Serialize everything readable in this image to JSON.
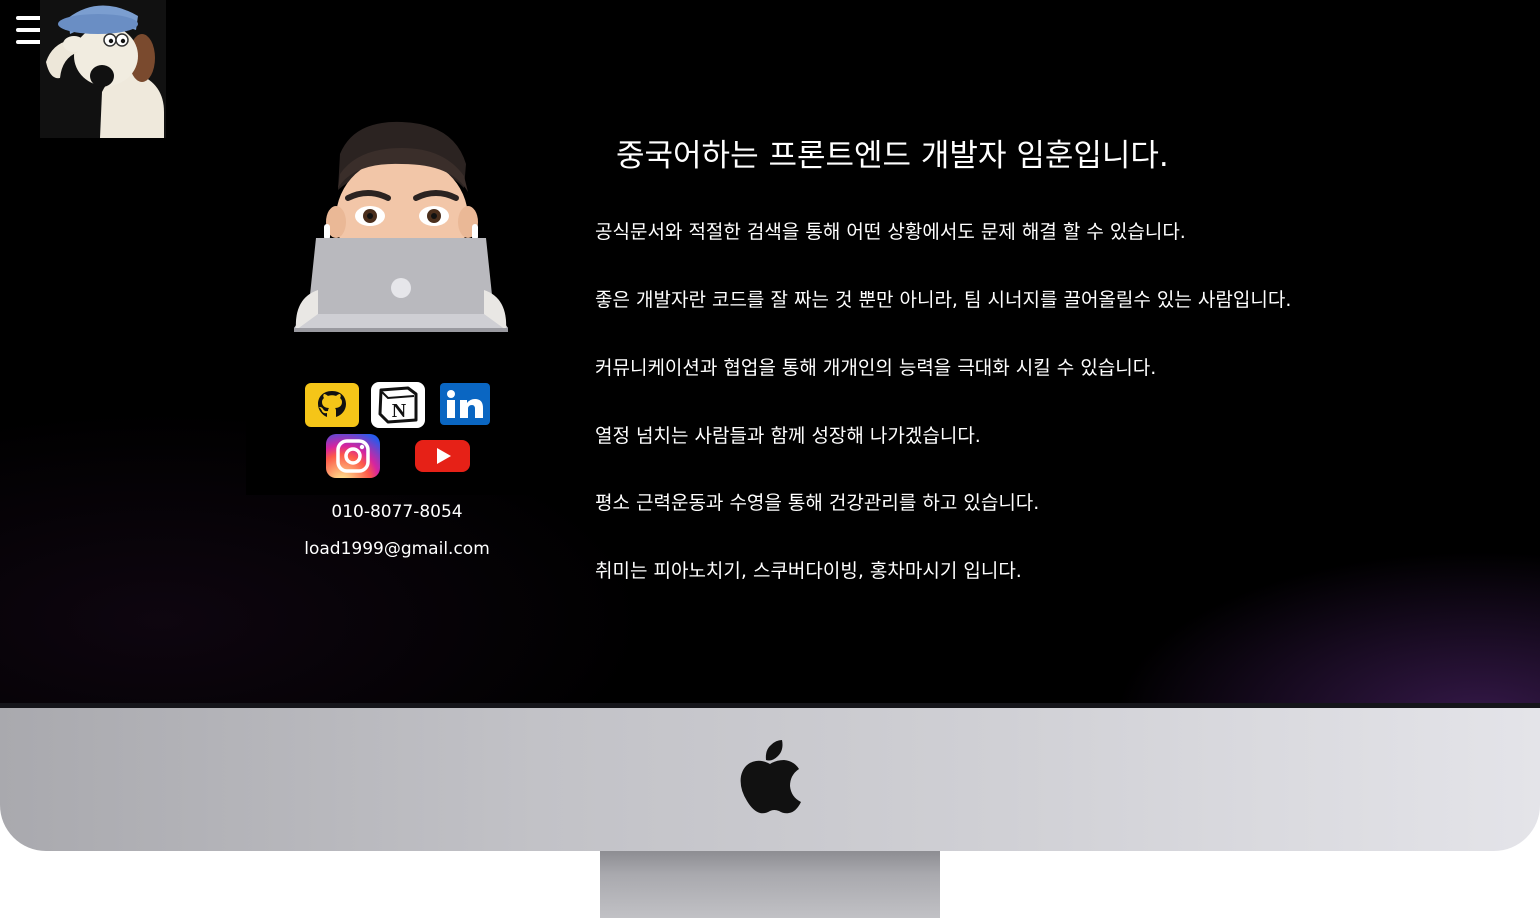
{
  "menu": {
    "icon": "hamburger-menu-icon"
  },
  "profile": {
    "mascot_icon": "clay-dog-mascot",
    "avatar_icon": "memoji-avatar-with-laptop",
    "phone": "010-8077-8054",
    "email": "load1999@gmail.com"
  },
  "socials": [
    {
      "name": "github",
      "icon": "github-icon",
      "color": "#f5c518"
    },
    {
      "name": "notion",
      "icon": "notion-icon",
      "color": "#ffffff"
    },
    {
      "name": "linkedin",
      "icon": "linkedin-icon",
      "color": "#0a66c2"
    },
    {
      "name": "instagram",
      "icon": "instagram-icon",
      "color": "#d6249f"
    },
    {
      "name": "youtube",
      "icon": "youtube-icon",
      "color": "#e62117"
    }
  ],
  "intro": {
    "headline": "중국어하는 프론트엔드 개발자 임훈입니다.",
    "lines": [
      "공식문서와 적절한 검색을 통해 어떤 상황에서도 문제 해결 할 수 있습니다.",
      "좋은 개발자란 코드를 잘 짜는 것 뿐만 아니라, 팀 시너지를 끌어올릴수 있는 사람입니다.",
      "커뮤니케이션과 협업을 통해 개개인의 능력을 극대화 시킬 수 있습니다.",
      "열정 넘치는 사람들과 함께 성장해 나가겠습니다.",
      "평소 근력운동과 수영을 통해 건강관리를 하고 있습니다.",
      "취미는 피아노치기, 스쿠버다이빙, 홍차마시기 입니다."
    ]
  },
  "device": {
    "logo_icon": "apple-logo-icon"
  }
}
